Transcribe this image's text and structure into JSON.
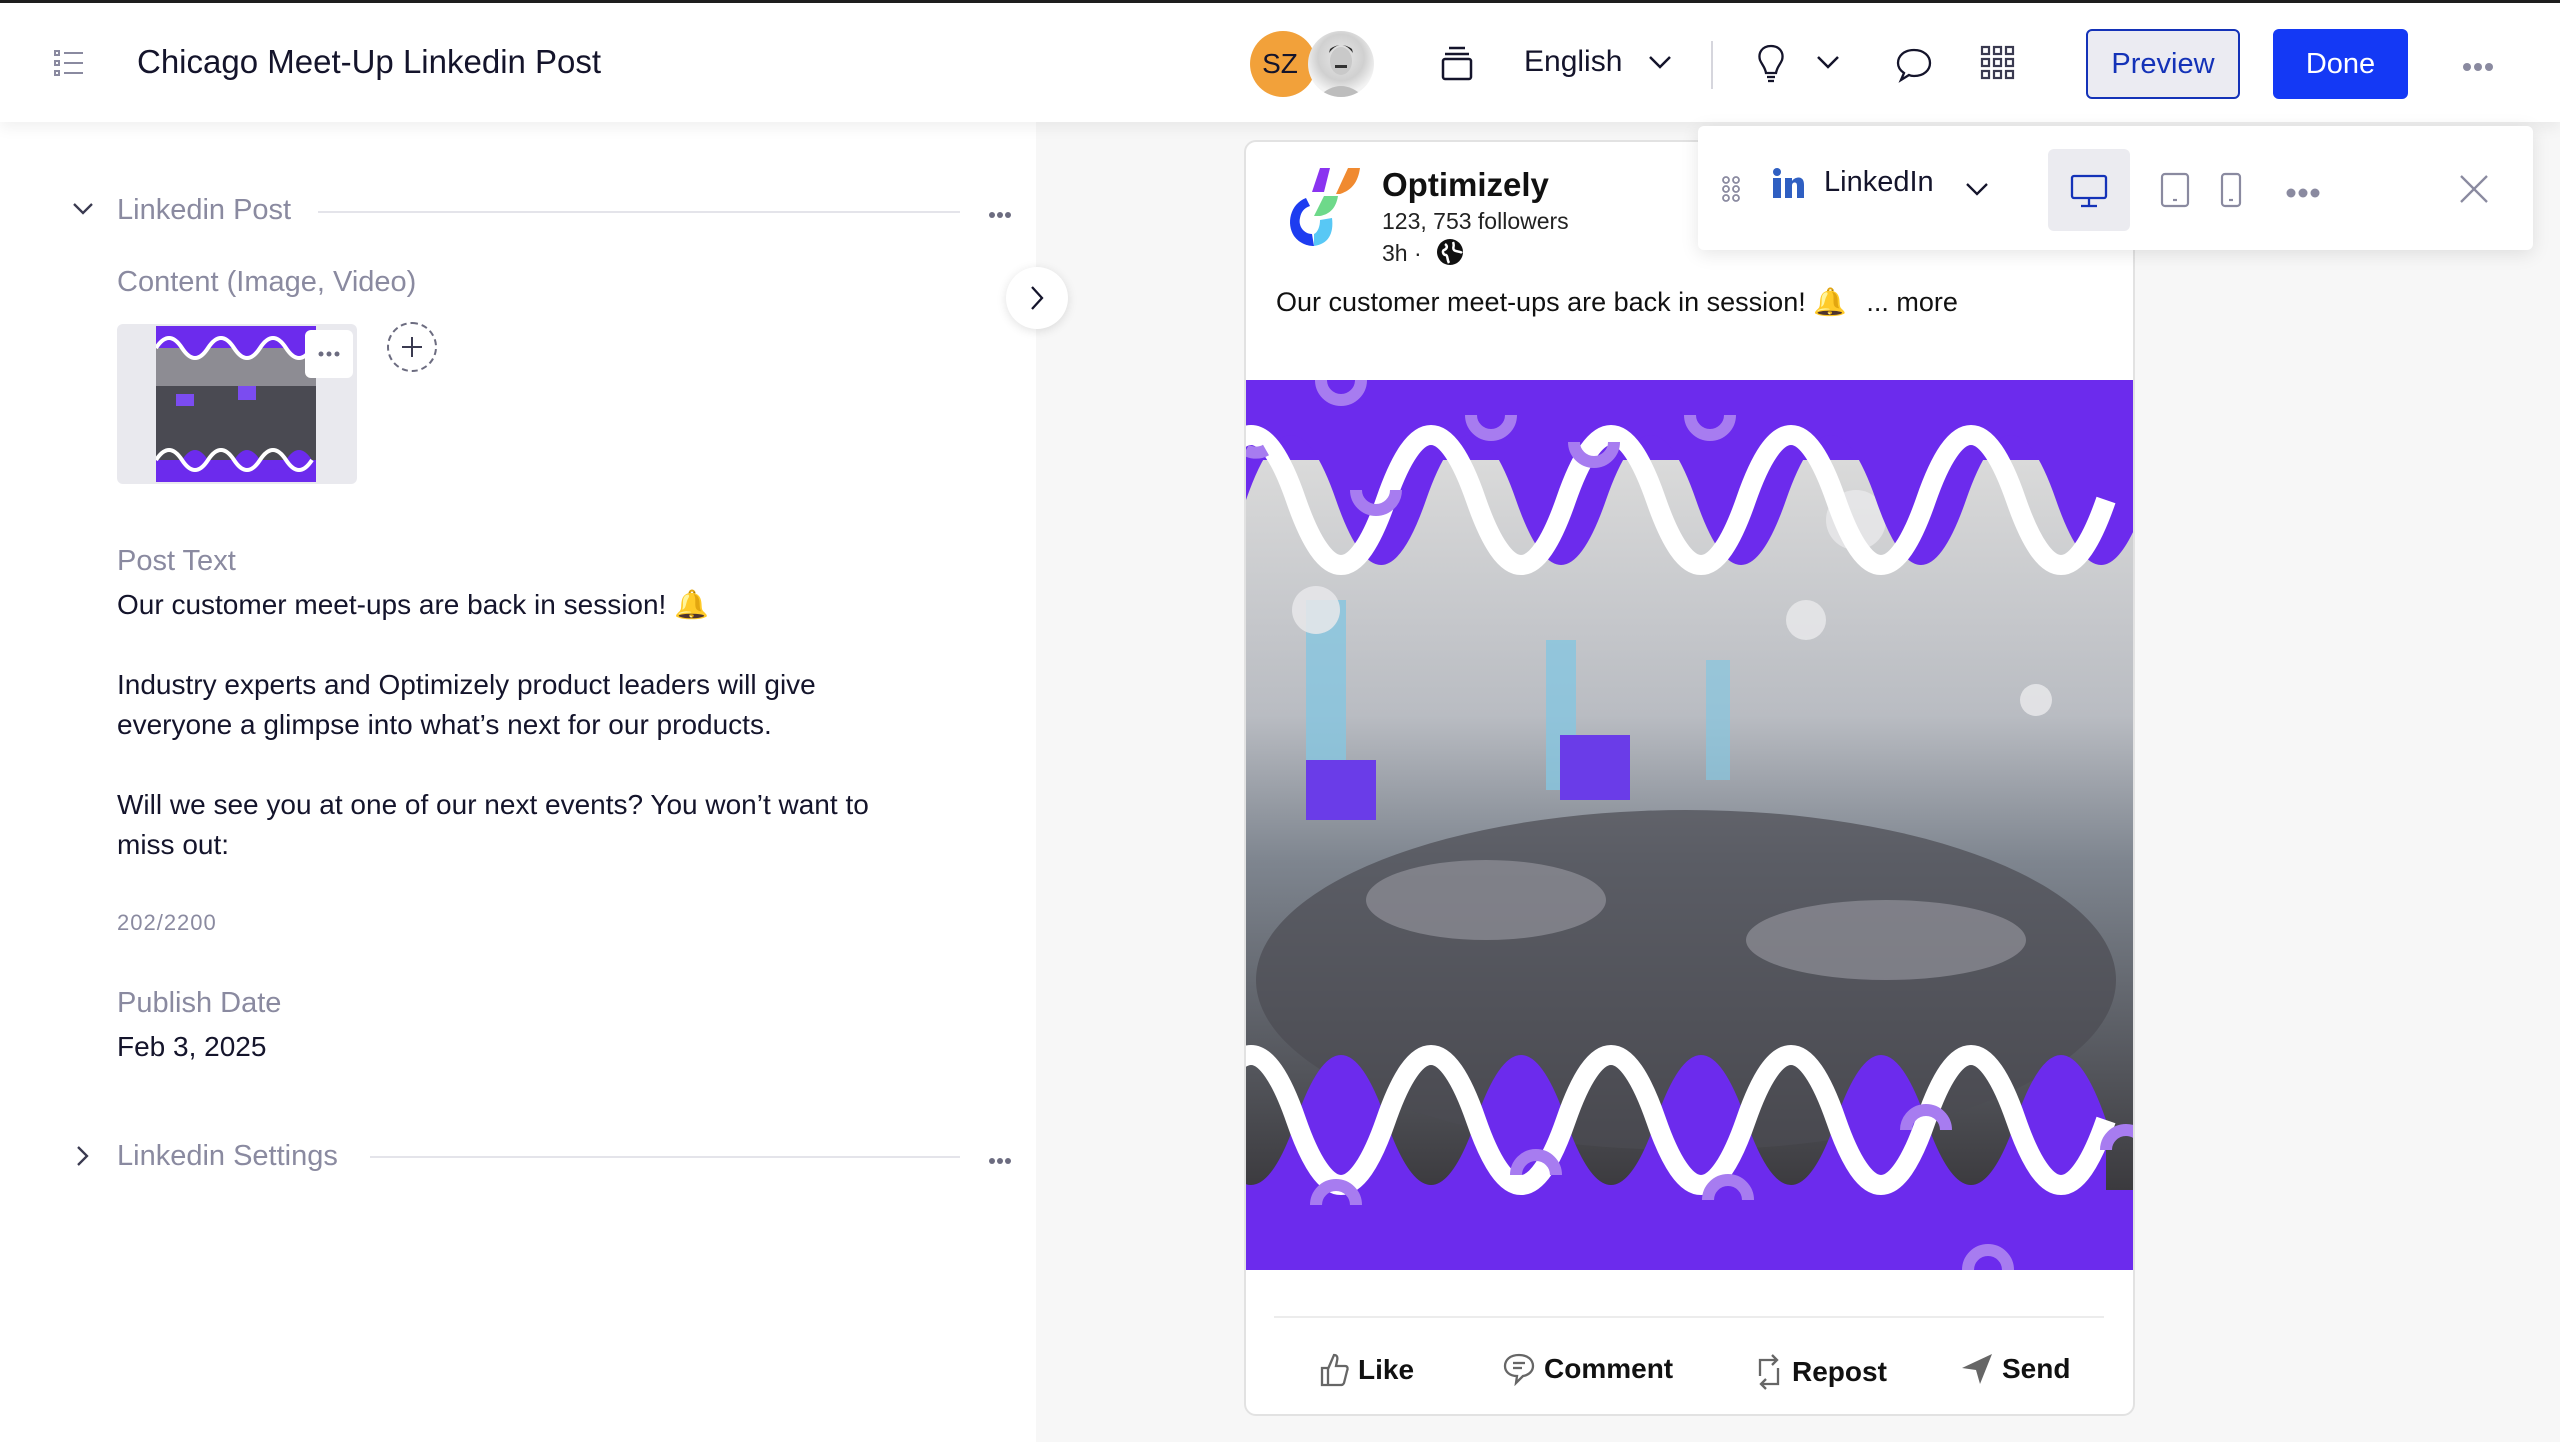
{
  "header": {
    "title": "Chicago Meet-Up Linkedin Post",
    "avatar_initials": "SZ",
    "language": "English",
    "preview_label": "Preview",
    "done_label": "Done"
  },
  "colors": {
    "primary": "#1439f5",
    "avatar_orange": "#f2a13a",
    "brand_purple": "#6c2bed",
    "linkedin_blue": "#2f5fc2"
  },
  "editor": {
    "sections": [
      {
        "label": "Linkedin Post",
        "expanded": true
      },
      {
        "label": "Linkedin Settings",
        "expanded": false
      }
    ],
    "content_label": "Content (Image, Video)",
    "post_text_label": "Post Text",
    "post_text_lines": [
      "Our customer meet-ups are back in session! 🔔",
      "Industry experts and Optimizely product leaders will give",
      "everyone a glimpse into what’s next for our products.",
      "Will we see you at one of our next events? You won’t want to",
      "miss out:"
    ],
    "char_count": "202/2200",
    "publish_date_label": "Publish Date",
    "publish_date": "Feb 3, 2025"
  },
  "preview_toolbar": {
    "channel": "LinkedIn",
    "devices": [
      "desktop",
      "tablet",
      "mobile"
    ],
    "active_device": "desktop"
  },
  "post": {
    "company": "Optimizely",
    "followers": "123, 753 followers",
    "age": "3h ·",
    "text": "Our customer meet-ups are back in session! 🔔",
    "more_label": "... more",
    "actions": [
      "Like",
      "Comment",
      "Repost",
      "Send"
    ]
  }
}
